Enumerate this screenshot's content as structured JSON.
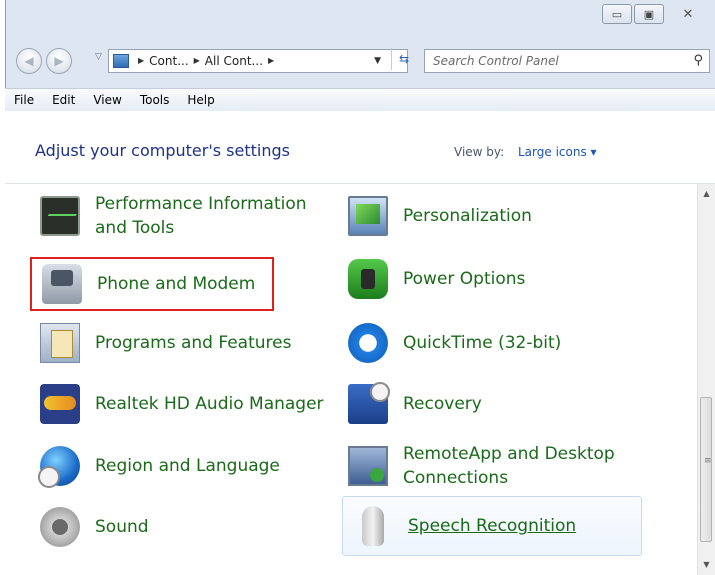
{
  "window": {
    "minimize_symbol": "▭",
    "maximize_symbol": "▣",
    "close_symbol": "✕"
  },
  "address": {
    "crumbs": [
      "Cont...",
      "All Cont..."
    ],
    "search_placeholder": "Search Control Panel"
  },
  "menu": [
    "File",
    "Edit",
    "View",
    "Tools",
    "Help"
  ],
  "content": {
    "heading": "Adjust your computer's settings",
    "view_by_label": "View by:",
    "view_by_value": "Large icons ▾"
  },
  "left_items": [
    {
      "label": "Performance Information and Tools",
      "icon": "performance-icon"
    },
    {
      "label": "Phone and Modem",
      "icon": "phone-modem-icon"
    },
    {
      "label": "Programs and Features",
      "icon": "programs-icon"
    },
    {
      "label": "Realtek HD Audio Manager",
      "icon": "realtek-audio-icon"
    },
    {
      "label": "Region and Language",
      "icon": "region-globe-icon"
    },
    {
      "label": "Sound",
      "icon": "speaker-icon"
    }
  ],
  "right_items": [
    {
      "label": "Personalization",
      "icon": "personalization-icon"
    },
    {
      "label": "Power Options",
      "icon": "battery-plug-icon"
    },
    {
      "label": "QuickTime (32-bit)",
      "icon": "quicktime-icon"
    },
    {
      "label": "Recovery",
      "icon": "recovery-icon"
    },
    {
      "label": "RemoteApp and Desktop Connections",
      "icon": "remoteapp-icon"
    },
    {
      "label": "Speech Recognition",
      "icon": "microphone-icon"
    }
  ],
  "highlight": {
    "selected_item": "Phone and Modem",
    "selected_color": "#e0201c",
    "hover_item": "Speech Recognition"
  },
  "colors": {
    "link_green": "#1a6a1a",
    "heading_blue": "#1e3287",
    "frame": "#dde6f1"
  }
}
